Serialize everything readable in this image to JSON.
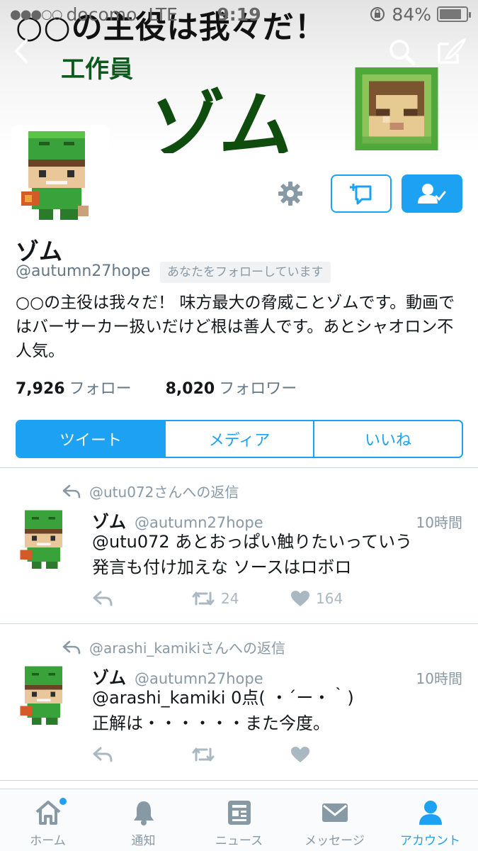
{
  "status_bar": {
    "signal": "●●●○○",
    "carrier": "docomo",
    "network": "LTE",
    "time": "9:19",
    "battery": "84%",
    "battery_level": 0.84
  },
  "banner": {
    "title": "○○の主役は我々だ！",
    "subtitle": "工作員",
    "big_name": "ゾム"
  },
  "profile": {
    "display_name": "ゾム",
    "handle": "@autumn27hope",
    "follows_you": "あなたをフォローしています",
    "bio": "○○の主役は我々だ！ 味方最大の脅威ことゾムです。動画ではバーサーカー扱いだけど根は善人です。あとシャオロン不人気。",
    "following_count": "7,926",
    "following_label": "フォロー",
    "followers_count": "8,020",
    "followers_label": "フォロワー"
  },
  "tabs": [
    {
      "label": "ツイート",
      "active": true
    },
    {
      "label": "メディア",
      "active": false
    },
    {
      "label": "いいね",
      "active": false
    }
  ],
  "tweets": [
    {
      "reply_context": "@utu072さんへの返信",
      "name": "ゾム",
      "handle": "@autumn27hope",
      "time": "10時間",
      "text_line1": "@utu072 あとおっぱい触りたいっていう",
      "text_line2": "発言も付け加えな ソースはロボロ",
      "retweets": "24",
      "likes": "164"
    },
    {
      "reply_context": "@arashi_kamikiさんへの返信",
      "name": "ゾム",
      "handle": "@autumn27hope",
      "time": "10時間",
      "text_line1": "@arashi_kamiki 0点( ・´ー・｀)",
      "text_line2": "正解は・・・・・・また今度。",
      "retweets": "",
      "likes": ""
    }
  ],
  "tabbar": [
    {
      "label": "ホーム",
      "icon": "home-icon",
      "active": false
    },
    {
      "label": "通知",
      "icon": "bell-icon",
      "active": false
    },
    {
      "label": "ニュース",
      "icon": "news-icon",
      "active": false
    },
    {
      "label": "メッセージ",
      "icon": "envelope-icon",
      "active": false
    },
    {
      "label": "アカウント",
      "icon": "person-icon",
      "active": true
    }
  ],
  "colors": {
    "accent": "#1da1f2",
    "muted": "#8899a6",
    "banner_green": "#0f4d0f"
  }
}
